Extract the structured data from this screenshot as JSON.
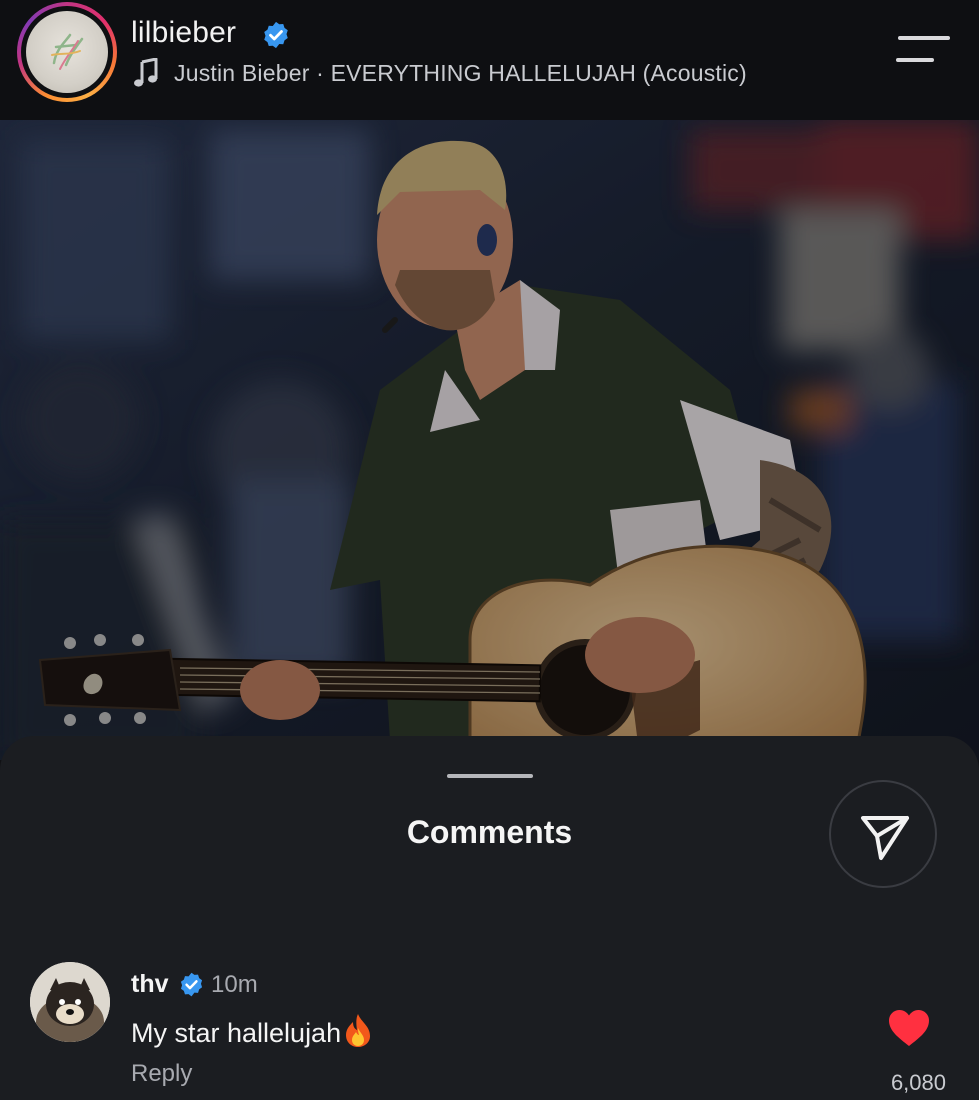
{
  "header": {
    "username": "lilbieber",
    "verified": true,
    "song": "Justin Bieber · EVERYTHING HALLELUJAH (Acoustic)",
    "icons": {
      "avatar": "profile-avatar",
      "music": "music-note-icon",
      "menu": "menu-icon"
    }
  },
  "post": {
    "image": "performer-with-acoustic-guitar-photo"
  },
  "comments_sheet": {
    "title": "Comments",
    "share_icon": "send-icon",
    "comments": [
      {
        "user": "thv",
        "verified": true,
        "time": "10m",
        "text": "My star hallelujah",
        "emoji": "fire-icon",
        "reply_label": "Reply",
        "like_count": "6,080"
      }
    ]
  },
  "colors": {
    "background": "#101114",
    "sheet": "#1b1d21",
    "verified_blue": "#3897f0",
    "like_red": "#ff3040",
    "secondary_text": "#a8aab0"
  }
}
